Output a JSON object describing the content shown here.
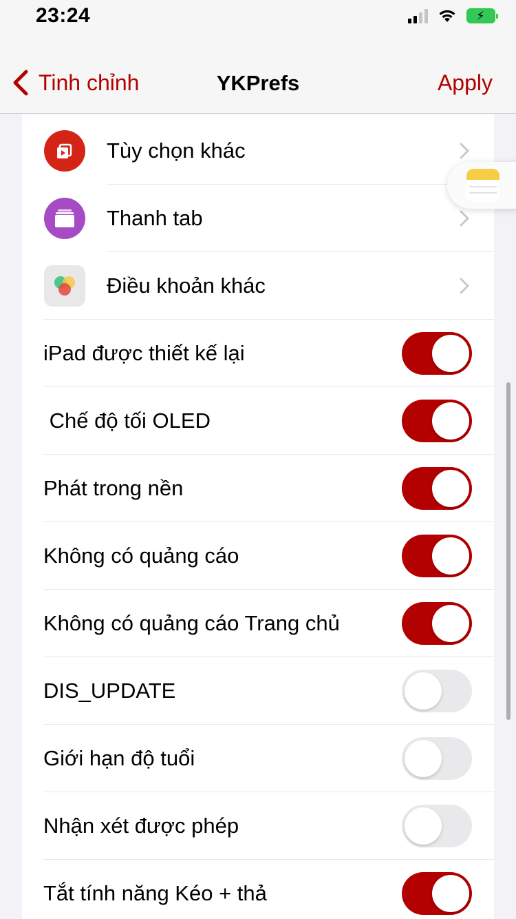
{
  "status_bar": {
    "time": "23:24",
    "icons": [
      "signal-icon",
      "wifi-icon",
      "battery-charging-icon"
    ]
  },
  "nav": {
    "back_label": "Tinh chỉnh",
    "title": "YKPrefs",
    "apply_label": "Apply"
  },
  "colors": {
    "accent": "#b30000",
    "toggle_off": "#e9e9eb",
    "background": "#f2f2f7"
  },
  "nav_items": [
    {
      "label": "Tùy chọn khác",
      "icon": "youtube-playlist-icon",
      "icon_color": "#d42416"
    },
    {
      "label": "Thanh tab",
      "icon": "tab-bar-icon",
      "icon_color": "#a64bc3"
    },
    {
      "label": "Điều khoản khác",
      "icon": "colorful-circles-icon",
      "icon_color": "#e8e8e8"
    }
  ],
  "toggles": [
    {
      "label": "iPad được thiết kế lại",
      "on": true
    },
    {
      "label": " Chế độ tối OLED",
      "on": true
    },
    {
      "label": "Phát trong nền",
      "on": true
    },
    {
      "label": "Không có quảng cáo",
      "on": true
    },
    {
      "label": "Không có quảng cáo Trang chủ",
      "on": true
    },
    {
      "label": "DIS_UPDATE",
      "on": false
    },
    {
      "label": "Giới hạn độ tuổi",
      "on": false
    },
    {
      "label": "Nhận xét được phép",
      "on": false
    },
    {
      "label": "Tắt tính năng Kéo + thả",
      "on": true
    }
  ]
}
